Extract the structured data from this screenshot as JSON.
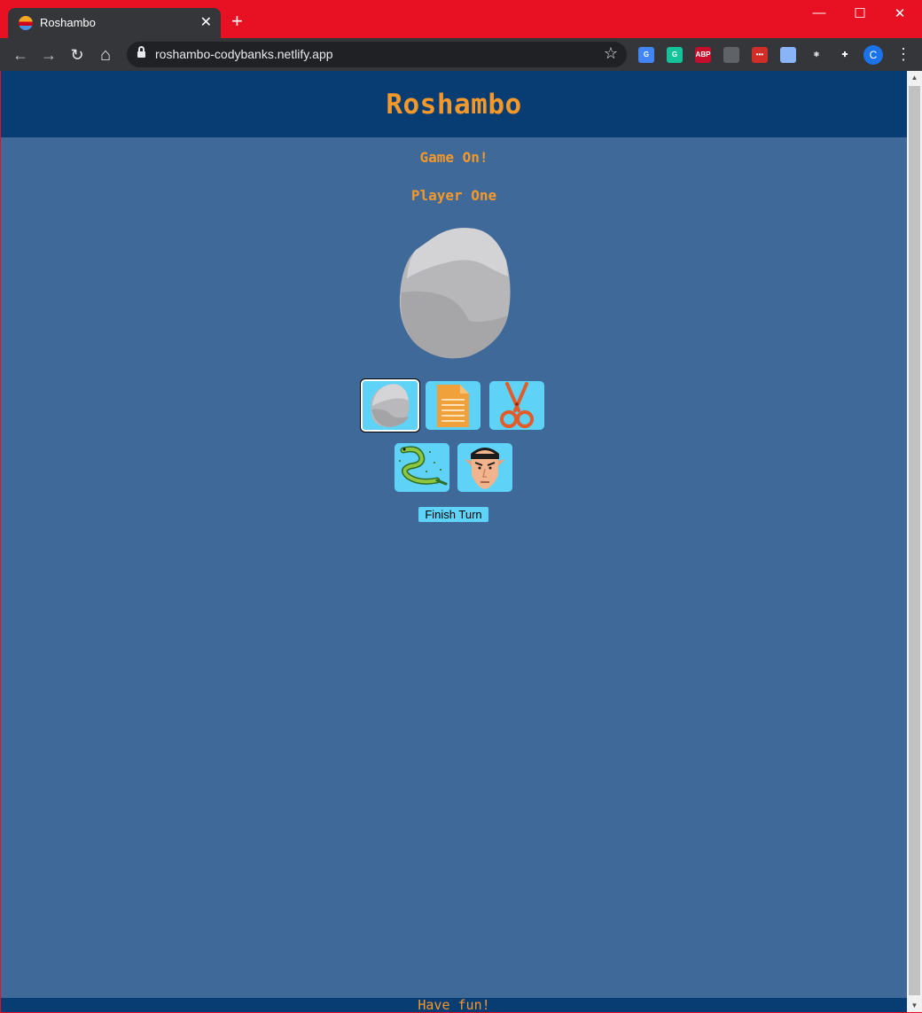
{
  "browser": {
    "tab_title": "Roshambo",
    "tab_close": "✕",
    "new_tab": "+",
    "url": "roshambo-codybanks.netlify.app",
    "window_controls": {
      "minimize": "—",
      "maximize": "☐",
      "close": "✕"
    },
    "nav": {
      "back": "←",
      "forward": "→",
      "reload": "↻",
      "home": "⌂"
    },
    "star": "☆",
    "extensions": [
      {
        "name": "google-translate-extension-icon",
        "text": "G",
        "color": "#4285f4"
      },
      {
        "name": "grammarly-extension-icon",
        "text": "G",
        "color": "#15c39a"
      },
      {
        "name": "adblock-plus-extension-icon",
        "text": "ABP",
        "color": "#c70d2c"
      },
      {
        "name": "shield-extension-icon",
        "text": "",
        "color": "#5f6368"
      },
      {
        "name": "lastpass-extension-icon",
        "text": "•••",
        "color": "#d32d27"
      },
      {
        "name": "ring-extension-icon",
        "text": "",
        "color": "#8ab4f8"
      },
      {
        "name": "react-devtools-extension-icon",
        "text": "⚛",
        "color": "#35363a"
      },
      {
        "name": "puzzle-extensions-icon",
        "text": "✚",
        "color": "#35363a"
      }
    ],
    "profile_initial": "C",
    "menu": "⋮"
  },
  "page": {
    "title": "Roshambo",
    "status": "Game On!",
    "player": "Player One",
    "choices": [
      {
        "name": "rock",
        "icon": "rock-icon",
        "selected": true
      },
      {
        "name": "paper",
        "icon": "paper-icon",
        "selected": false
      },
      {
        "name": "scissors",
        "icon": "scissors-icon",
        "selected": false
      },
      {
        "name": "lizard",
        "icon": "lizard-icon",
        "selected": false
      },
      {
        "name": "spock",
        "icon": "spock-icon",
        "selected": false
      }
    ],
    "finish_button": "Finish Turn",
    "footer": "Have fun!"
  },
  "colors": {
    "page_background": "#3e6999",
    "header_background": "#083d74",
    "accent_orange": "#f5982a",
    "choice_background": "#5fd3f7"
  }
}
